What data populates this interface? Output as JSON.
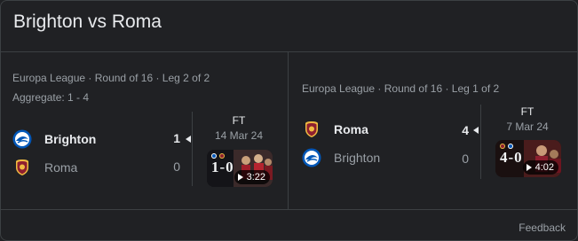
{
  "title": "Brighton vs Roma",
  "matches": [
    {
      "competition": "Europa League · Round of 16 · Leg 2 of 2",
      "aggregate": "Aggregate: 1 - 4",
      "teams": [
        {
          "name": "Brighton",
          "score": "1",
          "crest": "brighton-crest",
          "winner": true
        },
        {
          "name": "Roma",
          "score": "0",
          "crest": "roma-crest",
          "winner": false
        }
      ],
      "status": "FT",
      "date": "14 Mar 24",
      "video": {
        "score_overlay": "1-0",
        "duration": "3:22"
      }
    },
    {
      "competition": "Europa League · Round of 16 · Leg 1 of 2",
      "teams": [
        {
          "name": "Roma",
          "score": "4",
          "crest": "roma-crest",
          "winner": true
        },
        {
          "name": "Brighton",
          "score": "0",
          "crest": "brighton-crest",
          "winner": false
        }
      ],
      "status": "FT",
      "date": "7 Mar 24",
      "video": {
        "score_overlay": "4-0",
        "duration": "4:02"
      }
    }
  ],
  "feedback_label": "Feedback",
  "colors": {
    "background": "#202124",
    "text_primary": "#e8eaed",
    "text_secondary": "#9aa0a6",
    "divider": "#3c4043",
    "brighton_blue": "#0057b8",
    "roma_red": "#8e1f2f",
    "roma_gold": "#f0bc42"
  }
}
